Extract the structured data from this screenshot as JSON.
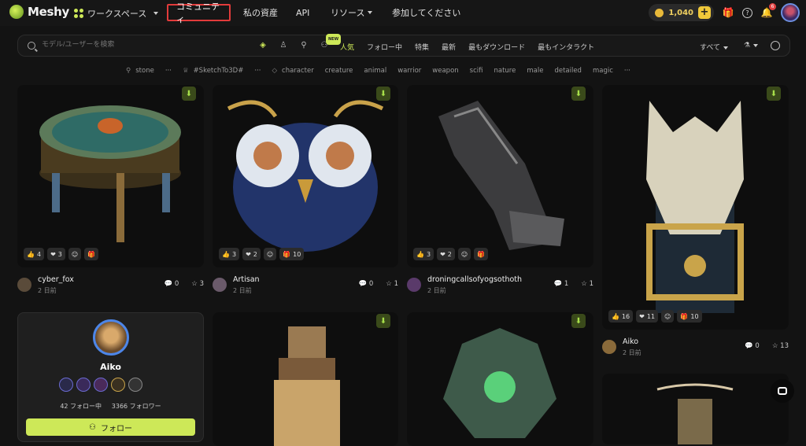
{
  "header": {
    "brand": "Meshy",
    "workspace": "ワークスペース",
    "nav": [
      "コミュニティ",
      "私の資産",
      "API",
      "リソース",
      "参加してください"
    ],
    "credits": "1,040",
    "notifications": "6"
  },
  "search": {
    "placeholder": "モデル/ユーザーを検索",
    "new_badge": "NEW",
    "tabs": [
      "人気",
      "フォロー中",
      "特集",
      "最新",
      "最もダウンロード",
      "最もインタラクト"
    ],
    "sort": "すべて"
  },
  "tags": {
    "group1": [
      "stone"
    ],
    "group2": [
      "#SketchTo3D#"
    ],
    "group3": [
      "character",
      "creature",
      "animal",
      "warrior",
      "weapon",
      "scifi",
      "nature",
      "male",
      "detailed",
      "magic"
    ]
  },
  "cards": [
    {
      "user": "cyber_fox",
      "date": "2 日前",
      "comments": "0",
      "stars": "3",
      "reacts": [
        "4",
        "3",
        "",
        ""
      ]
    },
    {
      "user": "Artisan",
      "date": "2 日前",
      "comments": "0",
      "stars": "1",
      "reacts": [
        "3",
        "2",
        "",
        "10"
      ]
    },
    {
      "user": "droningcallsofyogsothoth",
      "date": "2 日前",
      "comments": "1",
      "stars": "1",
      "reacts": [
        "3",
        "2",
        "",
        ""
      ]
    },
    {
      "user": "Aiko",
      "date": "2 日前",
      "comments": "0",
      "stars": "13",
      "reacts": [
        "16",
        "11",
        "",
        "10"
      ]
    }
  ],
  "profile": {
    "name": "Aiko",
    "following": "42 フォロー中",
    "followers": "3366 フォロワー",
    "follow_button": "フォロー"
  },
  "colors": {
    "accent": "#cde858",
    "highlight": "#e23b3b"
  }
}
